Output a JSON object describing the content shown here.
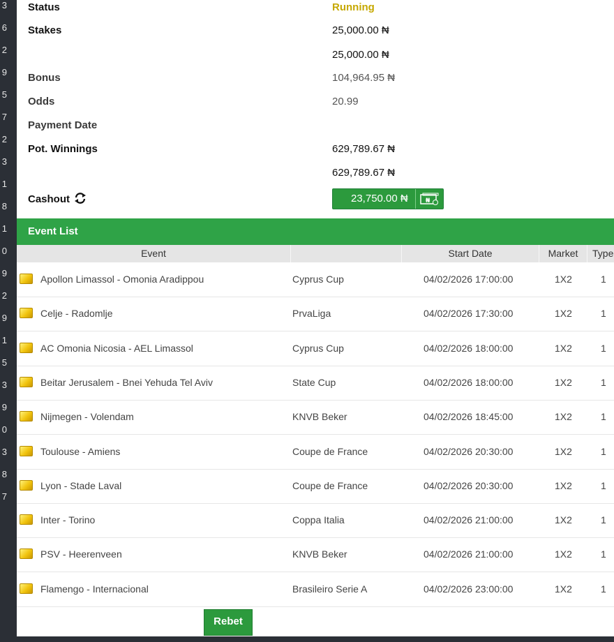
{
  "left_strip_digits": [
    "3",
    "6",
    "2",
    "9",
    "5",
    "7",
    "2",
    "3",
    "1",
    "8",
    "1",
    "0",
    "9",
    "2",
    "9",
    "1",
    "5",
    "3",
    "9",
    "0",
    "3",
    "8",
    "7"
  ],
  "ticket": {
    "status_label": "Status",
    "status_value": "Running",
    "stakes_label": "Stakes",
    "stakes_value_1": "25,000.00 ₦",
    "stakes_value_2": "25,000.00 ₦",
    "bonus_label": "Bonus",
    "bonus_value": "104,964.95 ₦",
    "odds_label": "Odds",
    "odds_value": "20.99",
    "payment_date_label": "Payment Date",
    "payment_date_value": "",
    "pot_winnings_label": "Pot. Winnings",
    "pot_winnings_value_1": "629,789.67 ₦",
    "pot_winnings_value_2": "629,789.67 ₦",
    "cashout_label": "Cashout",
    "cashout_amount": "23,750.00 ₦"
  },
  "event_list": {
    "title": "Event List",
    "columns": [
      "Event",
      "",
      "Start Date",
      "Market",
      "Type"
    ],
    "rows": [
      {
        "event": "Apollon Limassol - Omonia Aradippou",
        "league": "Cyprus Cup",
        "start": "04/02/2026 17:00:00",
        "market": "1X2",
        "type": "1"
      },
      {
        "event": "Celje - Radomlje",
        "league": "PrvaLiga",
        "start": "04/02/2026 17:30:00",
        "market": "1X2",
        "type": "1"
      },
      {
        "event": "AC Omonia Nicosia - AEL Limassol",
        "league": "Cyprus Cup",
        "start": "04/02/2026 18:00:00",
        "market": "1X2",
        "type": "1"
      },
      {
        "event": "Beitar Jerusalem - Bnei Yehuda Tel Aviv",
        "league": "State Cup",
        "start": "04/02/2026 18:00:00",
        "market": "1X2",
        "type": "1"
      },
      {
        "event": "Nijmegen - Volendam",
        "league": "KNVB Beker",
        "start": "04/02/2026 18:45:00",
        "market": "1X2",
        "type": "1"
      },
      {
        "event": "Toulouse - Amiens",
        "league": "Coupe de France",
        "start": "04/02/2026 20:30:00",
        "market": "1X2",
        "type": "1"
      },
      {
        "event": "Lyon - Stade Laval",
        "league": "Coupe de France",
        "start": "04/02/2026 20:30:00",
        "market": "1X2",
        "type": "1"
      },
      {
        "event": "Inter - Torino",
        "league": "Coppa Italia",
        "start": "04/02/2026 21:00:00",
        "market": "1X2",
        "type": "1"
      },
      {
        "event": "PSV - Heerenveen",
        "league": "KNVB Beker",
        "start": "04/02/2026 21:00:00",
        "market": "1X2",
        "type": "1"
      },
      {
        "event": "Flamengo - Internacional",
        "league": "Brasileiro Serie A",
        "start": "04/02/2026 23:00:00",
        "market": "1X2",
        "type": "1"
      }
    ]
  },
  "rebet_label": "Rebet",
  "colors": {
    "green": "#2fa347",
    "status": "#c6a800",
    "dark_bg": "#2b2f36"
  }
}
